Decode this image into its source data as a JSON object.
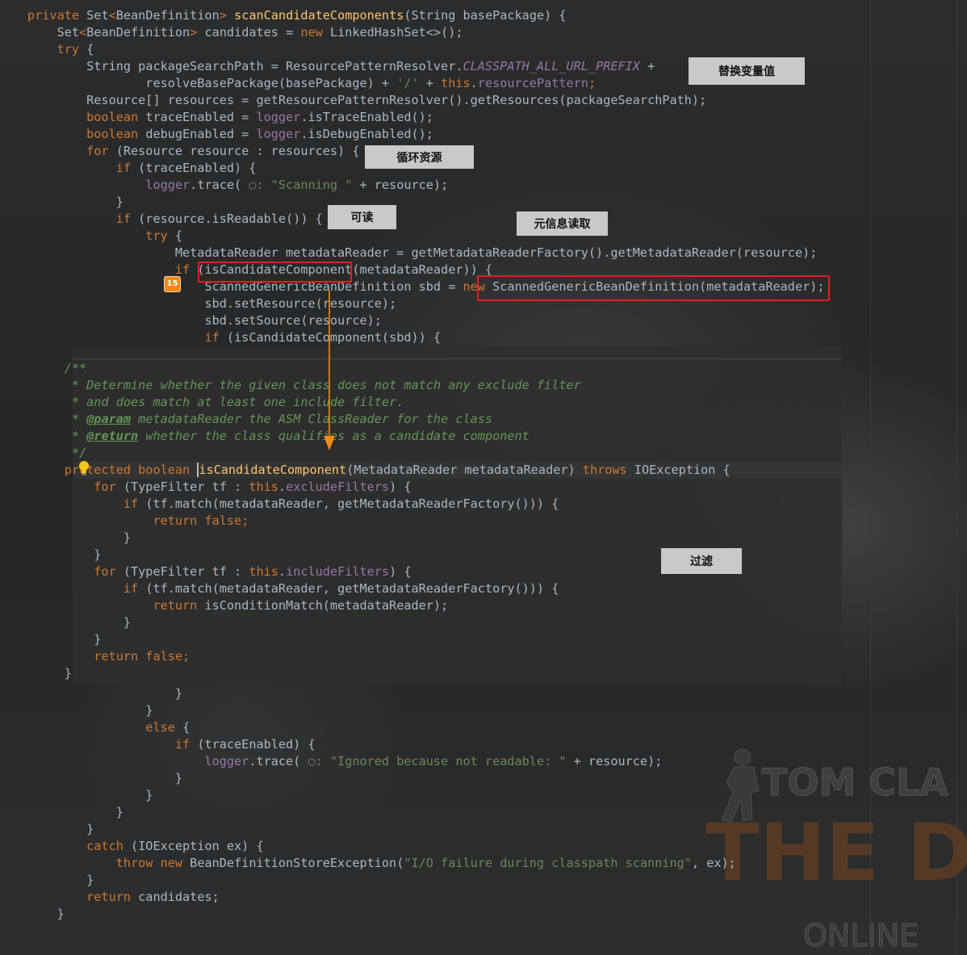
{
  "editor": {
    "lines": [
      [
        [
          "kw",
          "private "
        ],
        [
          "",
          "Set"
        ],
        [
          "kw",
          "<"
        ],
        [
          "",
          "BeanDefinition"
        ],
        [
          "kw",
          "> "
        ],
        [
          "fn",
          "scanCandidateComponents"
        ],
        [
          "",
          "(String basePackage) {"
        ]
      ],
      [
        [
          "",
          "    Set"
        ],
        [
          "kw",
          "<"
        ],
        [
          "",
          "BeanDefinition"
        ],
        [
          "kw",
          "> "
        ],
        [
          "",
          "candidates = "
        ],
        [
          "kw",
          "new "
        ],
        [
          "",
          "LinkedHashSet<>();"
        ]
      ],
      [
        [
          "kw",
          "    try "
        ],
        [
          "",
          "{"
        ]
      ],
      [
        [
          "",
          "        String packageSearchPath = ResourcePatternResolver."
        ],
        [
          "fld-i",
          "CLASSPATH_ALL_URL_PREFIX"
        ],
        [
          "",
          " +"
        ]
      ],
      [
        [
          "",
          "                resolveBasePackage(basePackage) + "
        ],
        [
          "str",
          "'/'"
        ],
        [
          "",
          " + "
        ],
        [
          "kw",
          "this"
        ],
        [
          "",
          "."
        ],
        [
          "fld",
          "resourcePattern"
        ],
        [
          "kw",
          ";"
        ]
      ],
      [
        [
          "",
          "        Resource[] resources = getResourcePatternResolver().getResources(packageSearchPath);"
        ]
      ],
      [
        [
          "kw",
          "        boolean "
        ],
        [
          "",
          "traceEnabled = "
        ],
        [
          "fld",
          "logger"
        ],
        [
          "",
          ".isTraceEnabled();"
        ]
      ],
      [
        [
          "kw",
          "        boolean "
        ],
        [
          "",
          "debugEnabled = "
        ],
        [
          "fld",
          "logger"
        ],
        [
          "",
          ".isDebugEnabled();"
        ]
      ],
      [
        [
          "kw",
          "        for "
        ],
        [
          "",
          "(Resource resource : resources) {"
        ]
      ],
      [
        [
          "kw",
          "            if "
        ],
        [
          "",
          "(traceEnabled) {"
        ]
      ],
      [
        [
          "fld",
          "                logger"
        ],
        [
          "",
          ".trace( "
        ],
        [
          "hint",
          "○: "
        ],
        [
          "str",
          "\"Scanning \""
        ],
        [
          "",
          " + resource);"
        ]
      ],
      [
        [
          "",
          "            }"
        ]
      ],
      [
        [
          "kw",
          "            if "
        ],
        [
          "",
          "(resource.isReadable()) {"
        ]
      ],
      [
        [
          "kw",
          "                try "
        ],
        [
          "",
          "{"
        ]
      ],
      [
        [
          "",
          "                    MetadataReader metadataReader = getMetadataReaderFactory().getMetadataReader(resource);"
        ]
      ],
      [
        [
          "kw",
          "                    if "
        ],
        [
          "",
          "(isCandidateComponent(metadataReader)) {"
        ]
      ],
      [
        [
          "",
          "                        ScannedGenericBeanDefinition sbd = "
        ],
        [
          "kw",
          "new "
        ],
        [
          "",
          "ScannedGenericBeanDefinition(metadataReader);"
        ]
      ],
      [
        [
          "",
          "                        sbd.setResource(resource);"
        ]
      ],
      [
        [
          "",
          "                        sbd.setSource(resource);"
        ]
      ],
      [
        [
          "kw",
          "                        if "
        ],
        [
          "",
          "(isCandidateComponent(sbd)) {"
        ]
      ]
    ],
    "popup_lines": [
      [
        [
          "doc",
          "     /**"
        ]
      ],
      [
        [
          "doc",
          "      * Determine whether the given class does not match any exclude filter"
        ]
      ],
      [
        [
          "doc",
          "      * and does match at least one include filter."
        ]
      ],
      [
        [
          "doc",
          "      * "
        ],
        [
          "doctag",
          "@param"
        ],
        [
          "doc",
          " metadataReader the ASM ClassReader for the class"
        ]
      ],
      [
        [
          "doc",
          "      * "
        ],
        [
          "doctag",
          "@return"
        ],
        [
          "doc",
          " whether the class qualifies as a candidate component"
        ]
      ],
      [
        [
          "doc",
          "      */"
        ]
      ],
      [
        [
          "kw",
          "     protected boolean "
        ],
        [
          "cur",
          ""
        ],
        [
          "fn",
          "isCandidateComponent"
        ],
        [
          "",
          "(MetadataReader metadataReader) "
        ],
        [
          "kw",
          "throws "
        ],
        [
          "",
          "IOException {"
        ]
      ],
      [
        [
          "kw",
          "         for "
        ],
        [
          "",
          "(TypeFilter tf : "
        ],
        [
          "kw",
          "this"
        ],
        [
          "",
          "."
        ],
        [
          "fld",
          "excludeFilters"
        ],
        [
          "",
          ") {"
        ]
      ],
      [
        [
          "kw",
          "             if "
        ],
        [
          "",
          "(tf.match(metadataReader, getMetadataReaderFactory())) {"
        ]
      ],
      [
        [
          "kw",
          "                 return false;"
        ]
      ],
      [
        [
          "",
          "             }"
        ]
      ],
      [
        [
          "",
          "         }"
        ]
      ],
      [
        [
          "kw",
          "         for "
        ],
        [
          "",
          "(TypeFilter tf : "
        ],
        [
          "kw",
          "this"
        ],
        [
          "",
          "."
        ],
        [
          "fld",
          "includeFilters"
        ],
        [
          "",
          ") {"
        ]
      ],
      [
        [
          "kw",
          "             if "
        ],
        [
          "",
          "(tf.match(metadataReader, getMetadataReaderFactory())) {"
        ]
      ],
      [
        [
          "kw",
          "                 return "
        ],
        [
          "",
          "isConditionMatch(metadataReader);"
        ]
      ],
      [
        [
          "",
          "             }"
        ]
      ],
      [
        [
          "",
          "         }"
        ]
      ],
      [
        [
          "kw",
          "         return false;"
        ]
      ],
      [
        [
          "",
          "     }"
        ]
      ]
    ],
    "tail_lines": [
      [
        [
          "",
          "                    }"
        ]
      ],
      [
        [
          "",
          "                }"
        ]
      ],
      [
        [
          "kw",
          "                else "
        ],
        [
          "",
          "{"
        ]
      ],
      [
        [
          "kw",
          "                    if "
        ],
        [
          "",
          "(traceEnabled) {"
        ]
      ],
      [
        [
          "fld",
          "                        logger"
        ],
        [
          "",
          ".trace( "
        ],
        [
          "hint",
          "○: "
        ],
        [
          "str",
          "\"Ignored because not readable: \""
        ],
        [
          "",
          " + resource);"
        ]
      ],
      [
        [
          "",
          "                    }"
        ]
      ],
      [
        [
          "",
          "                }"
        ]
      ],
      [
        [
          "",
          "            }"
        ]
      ],
      [
        [
          "",
          "        }"
        ]
      ],
      [
        [
          "kw",
          "        catch "
        ],
        [
          "",
          "(IOException ex) {"
        ]
      ],
      [
        [
          "kw",
          "            throw new "
        ],
        [
          "",
          "BeanDefinitionStoreException("
        ],
        [
          "str",
          "\"I/O failure during classpath scanning\""
        ],
        [
          "",
          ", ex);"
        ]
      ],
      [
        [
          "",
          "        }"
        ]
      ],
      [
        [
          "kw",
          "        return "
        ],
        [
          "",
          "candidates;"
        ]
      ],
      [
        [
          "",
          "    }"
        ]
      ]
    ]
  },
  "annotations": {
    "replace_var": "替换变量值",
    "loop_resources": "循环资源",
    "readable": "可读",
    "meta_read": "元信息读取",
    "filter": "过滤"
  },
  "gutter": {
    "breakpoint_badge": "15",
    "bulb_icon": "lightbulb-icon"
  },
  "background_art": {
    "line1": "TOM CLA",
    "line2": "THE DIV",
    "line3": "ONLINE"
  },
  "colors": {
    "keyword": "#cc7832",
    "function": "#ffc66d",
    "field": "#9876aa",
    "string": "#6a8759",
    "doc": "#629755",
    "text": "#a9b7c6",
    "highlight_box": "#e51e1e",
    "arrow": "#f08b15"
  }
}
